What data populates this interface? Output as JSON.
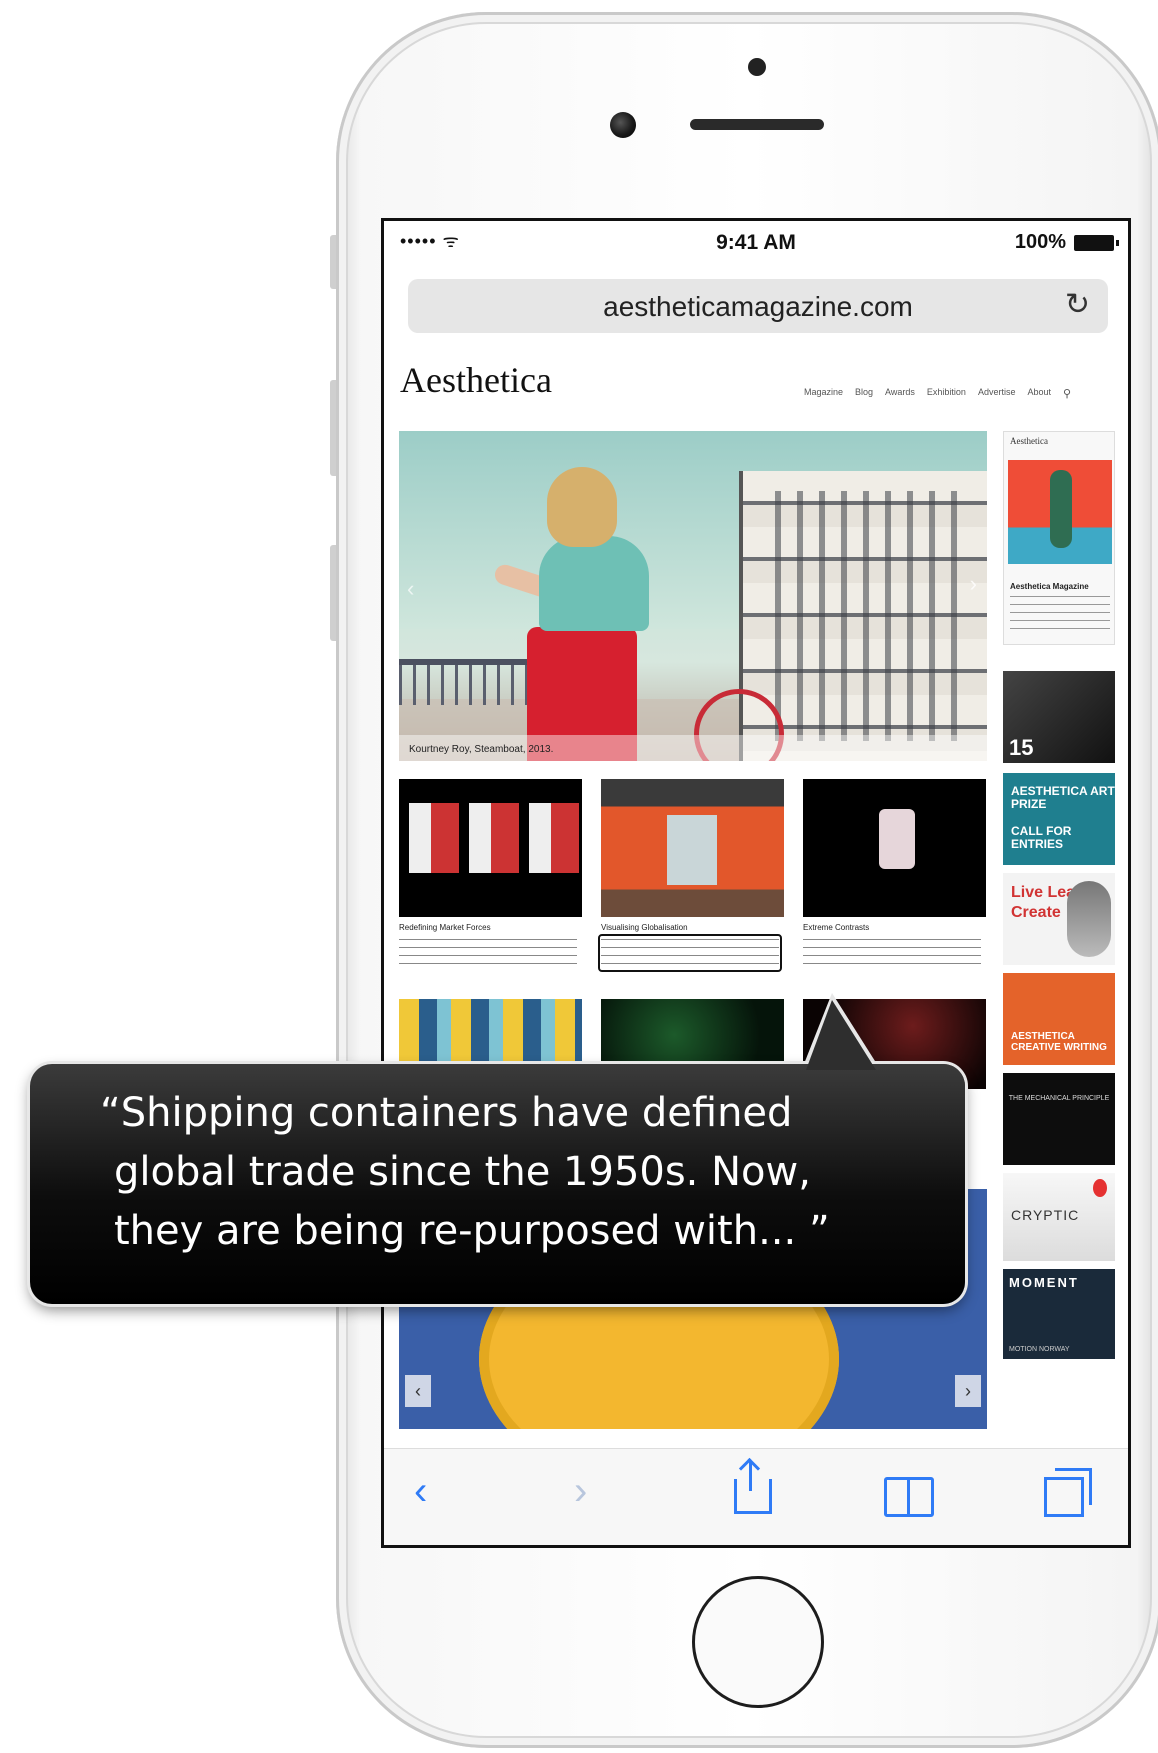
{
  "status_bar": {
    "signal": "••••• ᯤ",
    "time": "9:41 AM",
    "battery": "100%"
  },
  "url_bar": {
    "url": "aestheticamagazine.com",
    "reload_icon": "reload-icon"
  },
  "site": {
    "logo": "Aesthetica",
    "nav": [
      "Magazine",
      "Blog",
      "Awards",
      "Exhibition",
      "Advertise",
      "About"
    ],
    "hero_caption": "Kourtney Roy, Steamboat, 2013.",
    "articles": [
      {
        "title": "Redefining Market Forces"
      },
      {
        "title": "Visualising Globalisation"
      },
      {
        "title": "Extreme Contrasts"
      }
    ],
    "sidebar": {
      "magazine_title": "Aesthetica",
      "magazine_heading": "Aesthetica Magazine",
      "ad_number": "15",
      "prize_line1": "AESTHETICA ART PRIZE",
      "prize_line2": "CALL FOR ENTRIES",
      "live_text": "Live Learn Create",
      "orange_text": "AESTHETICA CREATIVE WRITING",
      "black_text": "THE MECHANICAL PRINCIPLE",
      "cryptic_text": "CRYPTIC",
      "moment_text": "MOMENT",
      "moment_sub": "MOTION NORWAY"
    }
  },
  "toolbar": {
    "back_icon": "‹",
    "forward_icon": "›"
  },
  "callout": {
    "line1": "“Shipping containers have defined",
    "line2": "global trade since the 1950s. Now,",
    "line3": "they are being re-purposed with... ”"
  }
}
